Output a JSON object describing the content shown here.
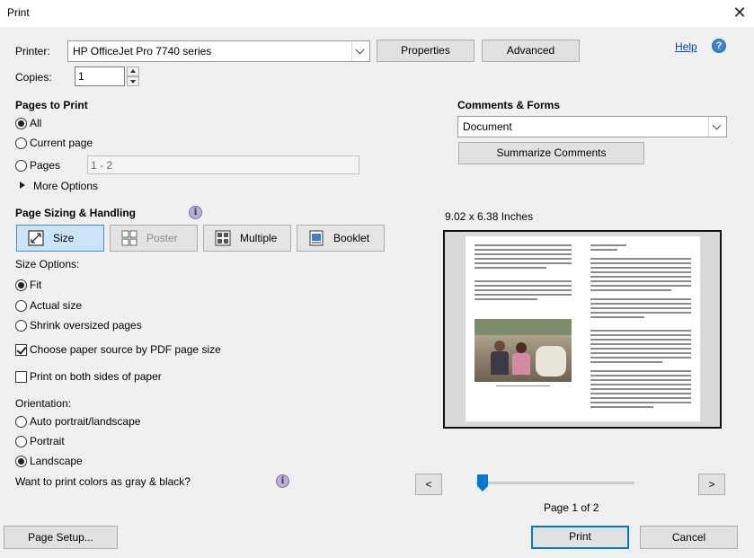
{
  "window": {
    "title": "Print",
    "close_glyph": "✕"
  },
  "printer": {
    "label": "Printer:",
    "selected": "HP OfficeJet Pro 7740 series",
    "properties_label": "Properties",
    "advanced_label": "Advanced",
    "help_label": "Help"
  },
  "copies": {
    "label": "Copies:",
    "value": "1"
  },
  "pages_to_print": {
    "heading": "Pages to Print",
    "all_label": "All",
    "current_label": "Current page",
    "pages_label": "Pages",
    "pages_value": "1 - 2",
    "more_options_label": "More Options",
    "selected": "All"
  },
  "sizing": {
    "heading": "Page Sizing & Handling",
    "tabs": [
      {
        "label": "Size",
        "icon": "size-icon",
        "state": "active"
      },
      {
        "label": "Poster",
        "icon": "poster-icon",
        "state": "disabled"
      },
      {
        "label": "Multiple",
        "icon": "multiple-icon",
        "state": "normal"
      },
      {
        "label": "Booklet",
        "icon": "booklet-icon",
        "state": "normal"
      }
    ],
    "size_options_label": "Size Options:",
    "fit_label": "Fit",
    "actual_label": "Actual size",
    "shrink_label": "Shrink oversized pages",
    "paper_source_label": "Choose paper source by PDF page size",
    "both_sides_label": "Print on both sides of paper",
    "selected_size_option": "Fit",
    "paper_source_checked": true,
    "both_sides_checked": false
  },
  "orientation": {
    "label": "Orientation:",
    "auto_label": "Auto portrait/landscape",
    "portrait_label": "Portrait",
    "landscape_label": "Landscape",
    "selected": "Landscape"
  },
  "gray": {
    "label": "Want to print colors as gray & black?"
  },
  "comments_forms": {
    "heading": "Comments & Forms",
    "selected": "Document",
    "summarize_label": "Summarize Comments"
  },
  "preview": {
    "dimensions": "9.02 x 6.38 Inches",
    "page_label": "Page 1 of 2",
    "current_page": 1,
    "total_pages": 2,
    "prev_glyph": "<",
    "next_glyph": ">"
  },
  "footer": {
    "page_setup_label": "Page Setup...",
    "print_label": "Print",
    "cancel_label": "Cancel"
  },
  "colors": {
    "accent": "#0078d7",
    "active_tab": "#cce4f7",
    "link": "#0645ad"
  }
}
